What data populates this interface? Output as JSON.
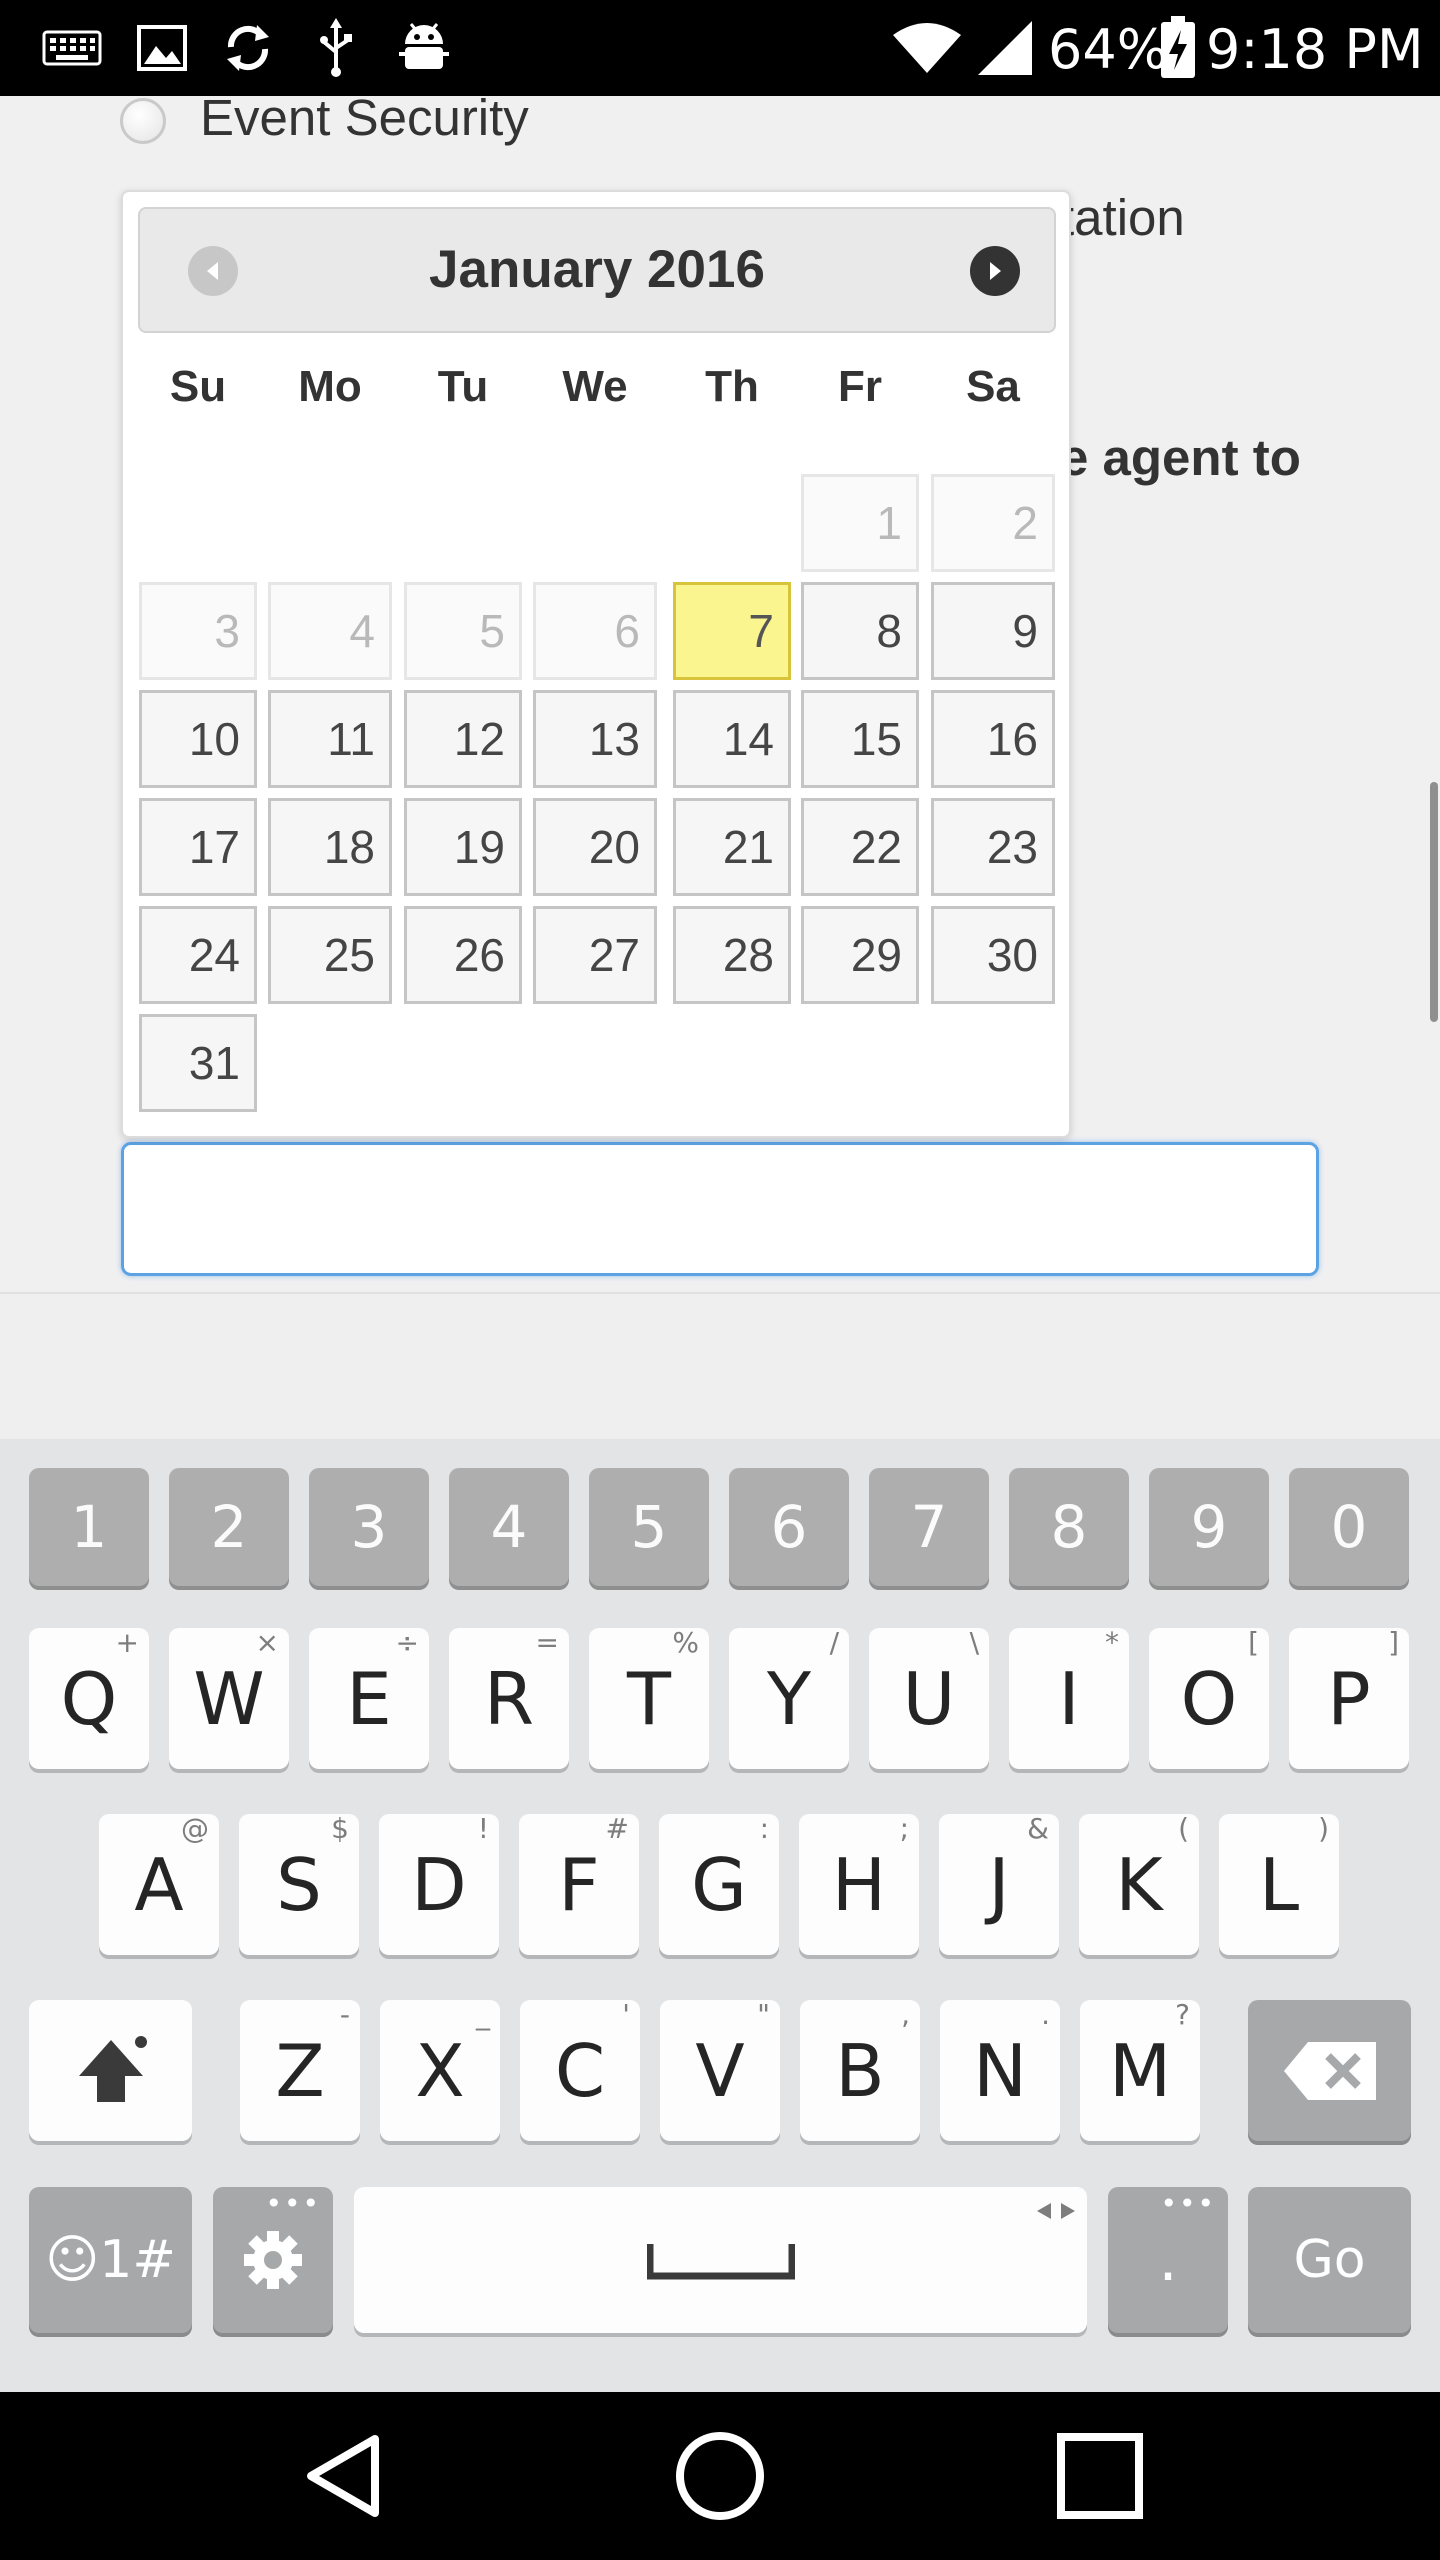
{
  "status_bar": {
    "battery": "64%",
    "time": "9:18 PM",
    "icons": [
      "keyboard-icon",
      "image-icon",
      "sync-icon",
      "usb-icon",
      "android-debug-icon",
      "wifi-icon",
      "cell-signal-icon",
      "battery-charging-icon"
    ]
  },
  "page": {
    "radio_label": "Event Security",
    "partial_text_1": "tation",
    "partial_text_2": "e agent to",
    "date_input": {
      "value": ""
    }
  },
  "datepicker": {
    "title": "January 2016",
    "weekdays": [
      "Su",
      "Mo",
      "Tu",
      "We",
      "Th",
      "Fr",
      "Sa"
    ],
    "today": "7",
    "weeks": [
      [
        "",
        "",
        "",
        "",
        "",
        "1",
        "2"
      ],
      [
        "3",
        "4",
        "5",
        "6",
        "7",
        "8",
        "9"
      ],
      [
        "10",
        "11",
        "12",
        "13",
        "14",
        "15",
        "16"
      ],
      [
        "17",
        "18",
        "19",
        "20",
        "21",
        "22",
        "23"
      ],
      [
        "24",
        "25",
        "26",
        "27",
        "28",
        "29",
        "30"
      ],
      [
        "31",
        "",
        "",
        "",
        "",
        "",
        ""
      ]
    ],
    "disabled_days": [
      "1",
      "2",
      "3",
      "4",
      "5",
      "6"
    ],
    "colors": {
      "today_bg": "#fbf58f",
      "header_bg": "#e9e9e9"
    }
  },
  "keyboard": {
    "numbers": [
      "1",
      "2",
      "3",
      "4",
      "5",
      "6",
      "7",
      "8",
      "9",
      "0"
    ],
    "row1": [
      {
        "key": "Q",
        "hint": "+"
      },
      {
        "key": "W",
        "hint": "×"
      },
      {
        "key": "E",
        "hint": "÷"
      },
      {
        "key": "R",
        "hint": "="
      },
      {
        "key": "T",
        "hint": "%"
      },
      {
        "key": "Y",
        "hint": "/"
      },
      {
        "key": "U",
        "hint": "\\"
      },
      {
        "key": "I",
        "hint": "*"
      },
      {
        "key": "O",
        "hint": "["
      },
      {
        "key": "P",
        "hint": "]"
      }
    ],
    "row2": [
      {
        "key": "A",
        "hint": "@"
      },
      {
        "key": "S",
        "hint": "$"
      },
      {
        "key": "D",
        "hint": "!"
      },
      {
        "key": "F",
        "hint": "#"
      },
      {
        "key": "G",
        "hint": ":"
      },
      {
        "key": "H",
        "hint": ";"
      },
      {
        "key": "J",
        "hint": "&"
      },
      {
        "key": "K",
        "hint": "("
      },
      {
        "key": "L",
        "hint": ")"
      }
    ],
    "row3": [
      {
        "key": "Z",
        "hint": "-"
      },
      {
        "key": "X",
        "hint": "_"
      },
      {
        "key": "C",
        "hint": "'"
      },
      {
        "key": "V",
        "hint": "\""
      },
      {
        "key": "B",
        "hint": ","
      },
      {
        "key": "N",
        "hint": "."
      },
      {
        "key": "M",
        "hint": "?"
      }
    ],
    "symbols_label": "☺1#",
    "period_label": ".",
    "go_label": "Go"
  }
}
